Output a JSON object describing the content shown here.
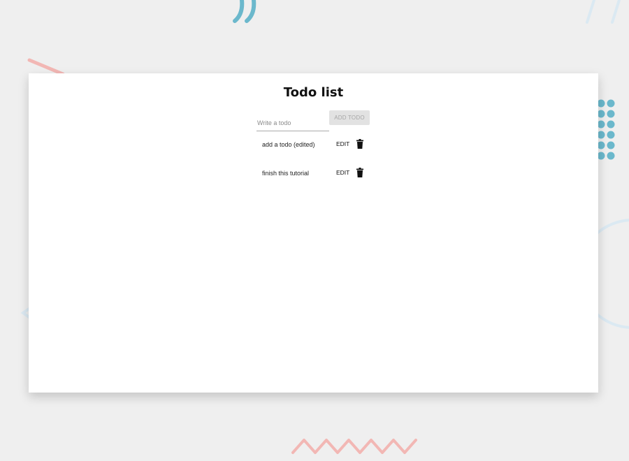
{
  "app": {
    "title": "Todo list"
  },
  "form": {
    "input_placeholder": "Write a todo",
    "input_value": "",
    "add_label": "ADD TODO",
    "add_enabled": false
  },
  "todos": [
    {
      "text": "add a todo (edited)",
      "edit_label": "EDIT",
      "delete_icon": "trash-icon"
    },
    {
      "text": "finish this tutorial",
      "edit_label": "EDIT",
      "delete_icon": "trash-icon"
    }
  ],
  "colors": {
    "background": "#efefef",
    "card": "#ffffff",
    "decor_blue": "#6bb8cc",
    "decor_pink": "#f2b7b4",
    "decor_light_blue": "#dbe9f2",
    "button_disabled_bg": "#e2e2e2",
    "button_disabled_text": "#a6a6a6"
  }
}
